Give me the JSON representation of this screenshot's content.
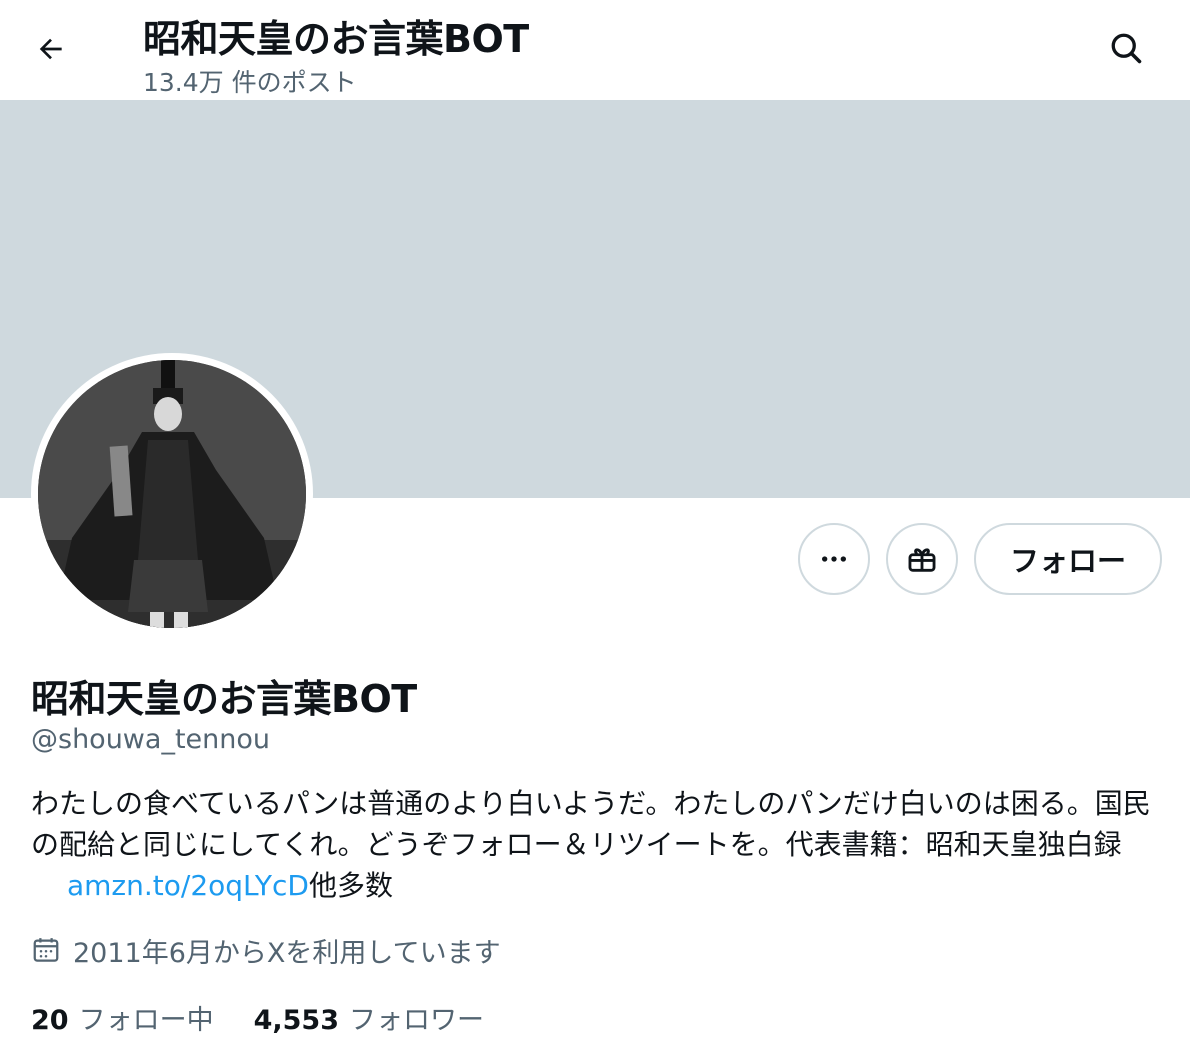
{
  "header": {
    "title": "昭和天皇のお言葉BOT",
    "post_count": "13.4万 件のポスト",
    "back_icon": "back-arrow-icon",
    "search_icon": "search-icon"
  },
  "banner": {
    "color": "#cfd9de"
  },
  "actions": {
    "more_icon": "more-dots-icon",
    "gift_icon": "gift-icon",
    "follow_label": "フォロー"
  },
  "profile": {
    "name": "昭和天皇のお言葉BOT",
    "handle": "@shouwa_tennou",
    "bio_text": "わたしの食べているパンは普通のより白いようだ。わたしのパンだけ白いのは困る。国民の配給と同じにしてくれ。どうぞフォロー＆リツイートを。代表書籍：昭和天皇独白録",
    "bio_link": "amzn.to/2oqLYcD",
    "bio_suffix": "他多数",
    "joined": "2011年6月からXを利用しています",
    "calendar_icon": "calendar-icon"
  },
  "stats": {
    "following_count": "20",
    "following_label": "フォロー中",
    "followers_count": "4,553",
    "followers_label": "フォロワー"
  },
  "colors": {
    "text": "#0f1419",
    "secondary": "#536471",
    "link": "#1d9bf0",
    "border": "#cfd9de"
  }
}
